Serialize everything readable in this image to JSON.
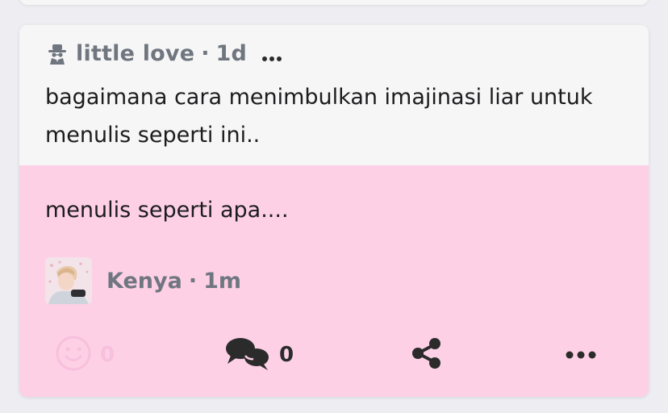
{
  "question": {
    "author": "little love",
    "time": "1d",
    "separator": "·",
    "text": "bagaimana cara menimbulkan imajinasi liar untuk menulis seperti ini.."
  },
  "answer": {
    "text": "menulis seperti apa....",
    "author": "Kenya",
    "time": "1m",
    "separator": "·"
  },
  "actions": {
    "like_count": "0",
    "comment_count": "0"
  },
  "icons": {
    "author_icon": "spy-icon",
    "like_icon": "smiley-icon",
    "comment_icon": "chat-bubbles-icon",
    "share_icon": "share-icon",
    "more_icon": "more-dots-icon"
  },
  "colors": {
    "question_bg": "#f6f6f6",
    "answer_bg": "#fdd0e6",
    "meta_text": "#707680",
    "like_disabled": "#f7c0dc"
  }
}
